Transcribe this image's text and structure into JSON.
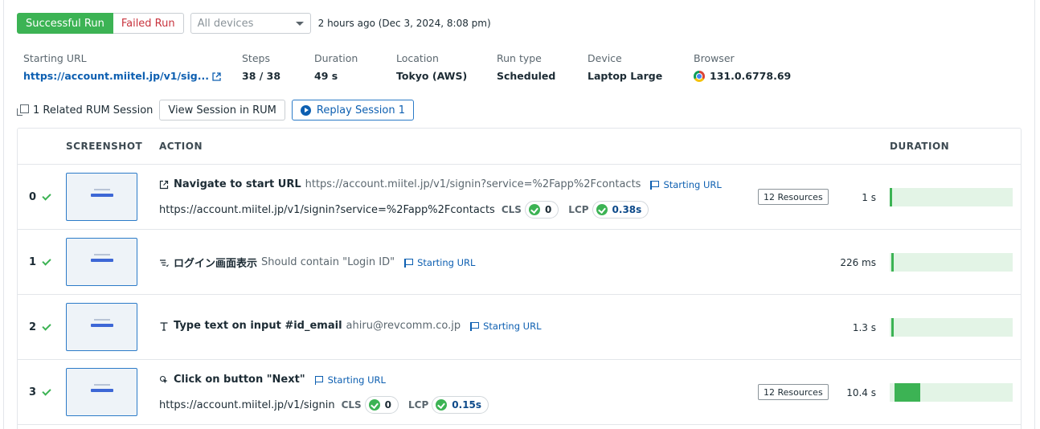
{
  "topbar": {
    "successful_run": "Successful Run",
    "failed_run": "Failed Run",
    "device_select": "All devices",
    "time": "2 hours ago (Dec 3, 2024, 8:08 pm)"
  },
  "meta": {
    "starting_url_label": "Starting URL",
    "starting_url_value": "https://account.miitel.jp/v1/sig...",
    "steps_label": "Steps",
    "steps_value": "38 / 38",
    "duration_label": "Duration",
    "duration_value": "49 s",
    "location_label": "Location",
    "location_value": "Tokyo (AWS)",
    "run_type_label": "Run type",
    "run_type_value": "Scheduled",
    "device_label": "Device",
    "device_value": "Laptop Large",
    "browser_label": "Browser",
    "browser_value": "131.0.6778.69"
  },
  "rum": {
    "related": "1 Related RUM Session",
    "view_session": "View Session in RUM",
    "replay_session": "Replay Session 1"
  },
  "table": {
    "headers": {
      "screenshot": "SCREENSHOT",
      "action": "ACTION",
      "duration": "DURATION"
    },
    "rows": [
      {
        "index": "0",
        "icon": "external-link-icon",
        "title": "Navigate to start URL",
        "desc": "https://account.miitel.jp/v1/signin?service=%2Fapp%2Fcontacts",
        "flag": "Starting URL",
        "url": "https://account.miitel.jp/v1/signin?service=%2Fapp%2Fcontacts",
        "cls_label": "CLS",
        "cls_value": "0",
        "lcp_label": "LCP",
        "lcp_value": "0.38s",
        "resources": "12 Resources",
        "duration": "1 s",
        "bar_fraction": 0.02
      },
      {
        "index": "1",
        "icon": "assertion-icon",
        "title": "ログイン画面表示",
        "desc": "Should contain \"Login ID\"",
        "flag": "Starting URL",
        "duration": "226 ms",
        "bar_fraction": 0.02
      },
      {
        "index": "2",
        "icon": "text-icon",
        "title": "Type text on input #id_email",
        "desc": "ahiru@revcomm.co.jp",
        "flag": "Starting URL",
        "duration": "1.3 s",
        "bar_fraction": 0.025
      },
      {
        "index": "3",
        "icon": "click-icon",
        "title": "Click on button \"Next\"",
        "flag": "Starting URL",
        "url": "https://account.miitel.jp/v1/signin",
        "cls_label": "CLS",
        "cls_value": "0",
        "lcp_label": "LCP",
        "lcp_value": "0.15s",
        "resources": "12 Resources",
        "duration": "10.4 s",
        "bar_fraction": 0.2
      }
    ]
  },
  "colors": {
    "success": "#3cb354",
    "failed": "#c8343e",
    "link": "#0d5fb1",
    "bar_bg": "#e3f4e6"
  }
}
